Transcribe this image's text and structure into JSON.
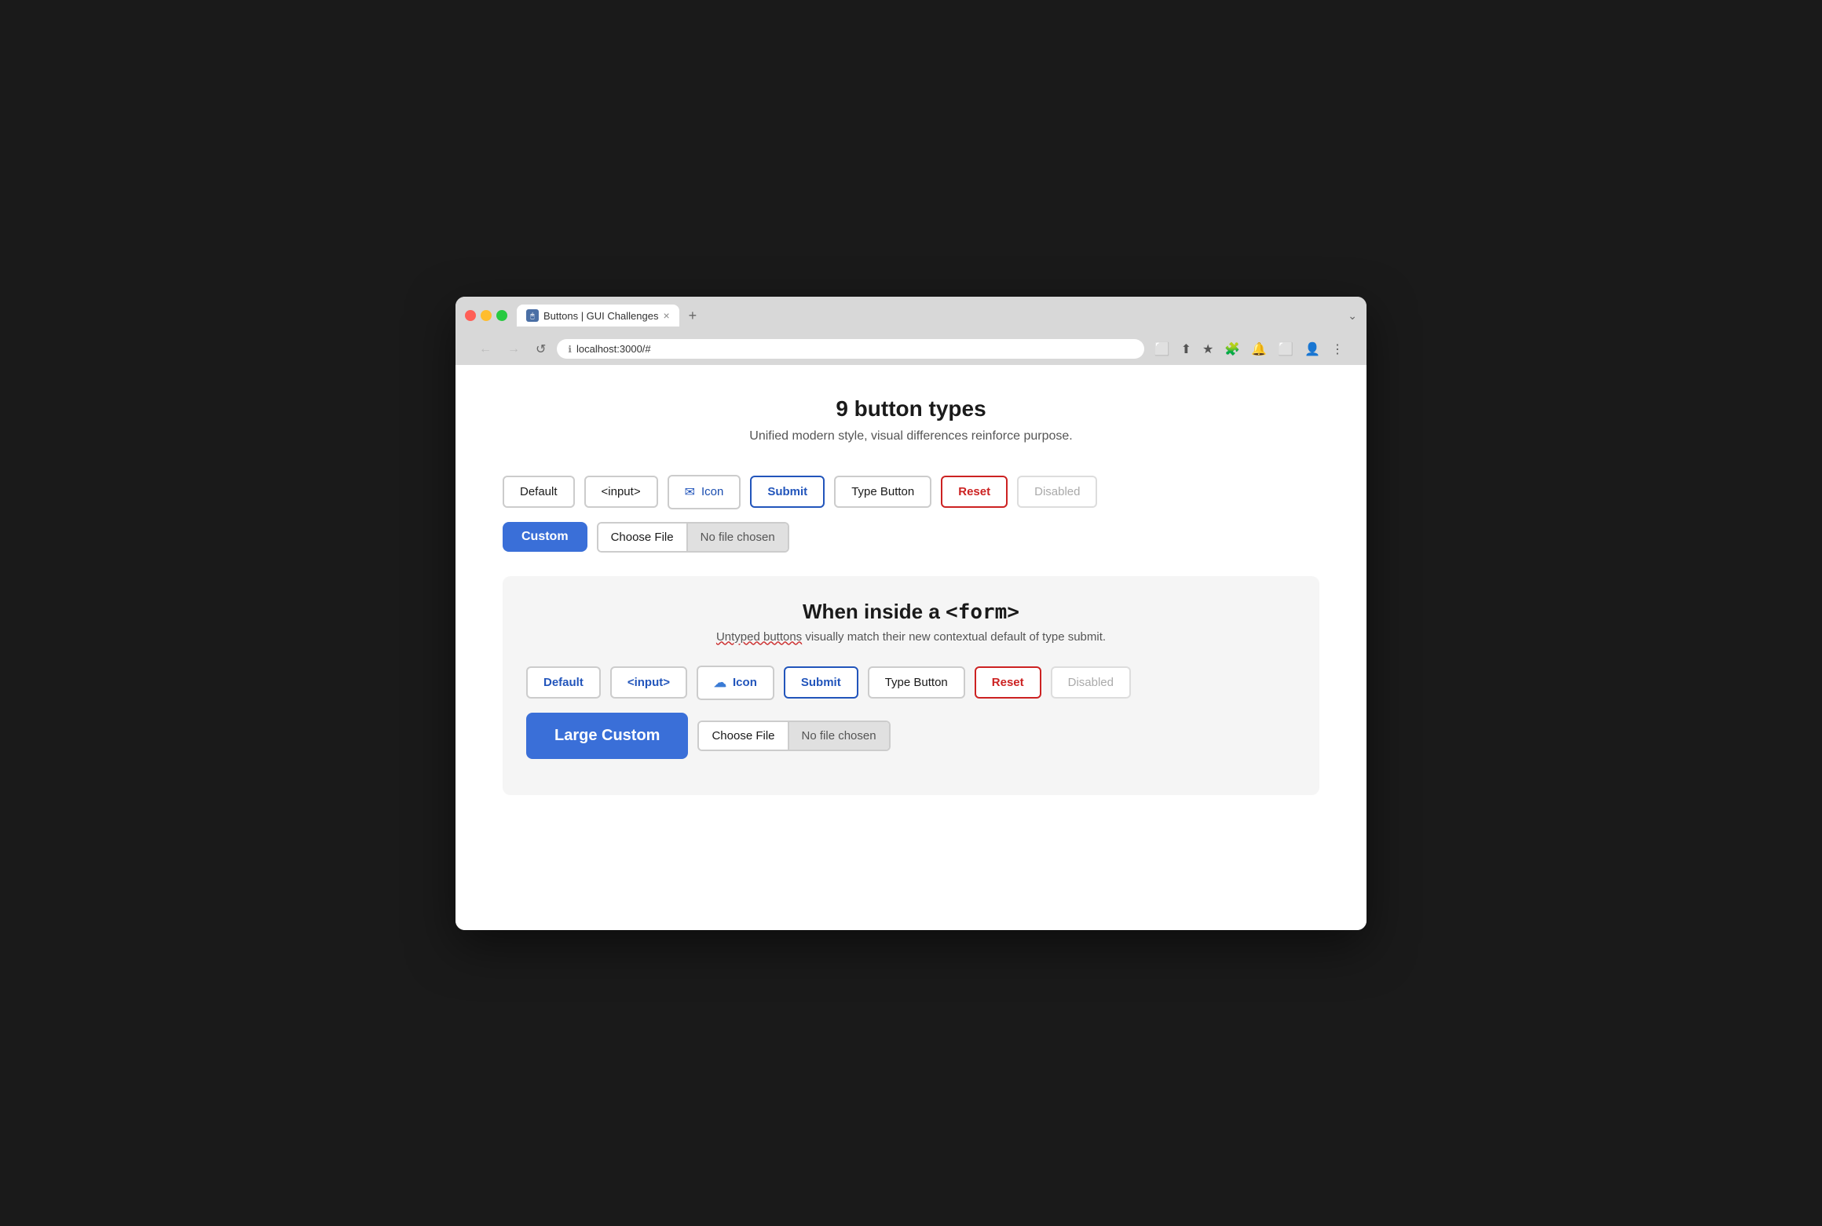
{
  "browser": {
    "traffic_lights": [
      "red",
      "yellow",
      "green"
    ],
    "tab_title": "Buttons | GUI Challenges",
    "tab_close": "×",
    "tab_new": "+",
    "url": "localhost:3000/#",
    "nav": {
      "back": "←",
      "forward": "→",
      "reload": "↺"
    },
    "toolbar_icons": [
      "⬜",
      "⬆",
      "★",
      "🔴",
      "🧩",
      "🔔",
      "⬜",
      "👤",
      "⋮"
    ]
  },
  "page": {
    "main_title": "9 button types",
    "main_subtitle": "Unified modern style, visual differences reinforce purpose.",
    "buttons_row1": [
      {
        "label": "Default",
        "type": "default"
      },
      {
        "label": "<input>",
        "type": "input"
      },
      {
        "label": "Icon",
        "type": "icon"
      },
      {
        "label": "Submit",
        "type": "submit"
      },
      {
        "label": "Type Button",
        "type": "type-button"
      },
      {
        "label": "Reset",
        "type": "reset"
      },
      {
        "label": "Disabled",
        "type": "disabled"
      }
    ],
    "custom_button": "Custom",
    "choose_file_label": "Choose File",
    "no_file_chosen": "No file chosen",
    "form_section": {
      "title_text": "When inside a ",
      "title_code": "<form>",
      "subtitle_normal": " visually match their new contextual default of type submit.",
      "subtitle_underline": "Untyped buttons",
      "form_buttons_row": [
        {
          "label": "Default",
          "type": "default"
        },
        {
          "label": "<input>",
          "type": "input"
        },
        {
          "label": "Icon",
          "type": "icon"
        },
        {
          "label": "Submit",
          "type": "submit"
        },
        {
          "label": "Type Button",
          "type": "type-button"
        },
        {
          "label": "Reset",
          "type": "reset"
        },
        {
          "label": "Disabled",
          "type": "disabled"
        }
      ],
      "large_custom_label": "Large Custom",
      "choose_file_label": "Choose File",
      "no_file_chosen": "No file chosen"
    }
  }
}
